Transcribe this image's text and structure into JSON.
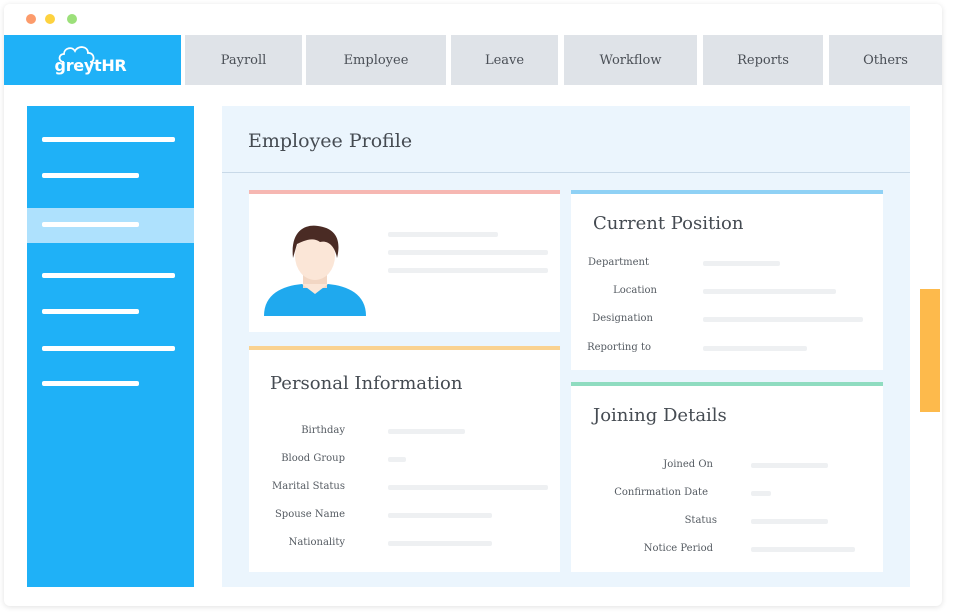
{
  "colors": {
    "brand_blue": "#1fb1f7",
    "sidebar_active": "#aee1fd",
    "tab_bg": "#dfe3e8",
    "main_bg": "#ebf5fd",
    "card_profile_accent": "#f6b7b2",
    "card_personal_accent": "#fad290",
    "card_position_accent": "#8fd1f5",
    "card_joining_accent": "#8fdcc0",
    "scroll_accent": "#fdba4c",
    "dot_red": "#fc9b6b",
    "dot_yellow": "#fdd23f",
    "dot_green": "#9ce07a"
  },
  "window": {
    "controls": [
      "close-dot",
      "minimize-dot",
      "maximize-dot"
    ]
  },
  "logo": {
    "text": "greytHR",
    "icon": "cloud-icon"
  },
  "nav": {
    "tabs": [
      {
        "label": "Payroll"
      },
      {
        "label": "Employee"
      },
      {
        "label": "Leave"
      },
      {
        "label": "Workflow"
      },
      {
        "label": "Reports"
      },
      {
        "label": "Others"
      }
    ]
  },
  "sidebar": {
    "item_count": 7,
    "active_index": 2
  },
  "main": {
    "page_title": "Employee Profile"
  },
  "profile_card": {
    "avatar_icon": "user-avatar-icon"
  },
  "personal_info": {
    "title": "Personal Information",
    "fields": [
      {
        "label": "Birthday"
      },
      {
        "label": "Blood Group"
      },
      {
        "label": "Marital Status"
      },
      {
        "label": "Spouse Name"
      },
      {
        "label": "Nationality"
      }
    ]
  },
  "current_position": {
    "title": "Current Position",
    "fields": [
      {
        "label": "Department"
      },
      {
        "label": "Location"
      },
      {
        "label": "Designation"
      },
      {
        "label": "Reporting to"
      }
    ]
  },
  "joining_details": {
    "title": "Joining Details",
    "fields": [
      {
        "label": "Joined On"
      },
      {
        "label": "Confirmation Date"
      },
      {
        "label": "Status"
      },
      {
        "label": "Notice Period"
      }
    ]
  }
}
